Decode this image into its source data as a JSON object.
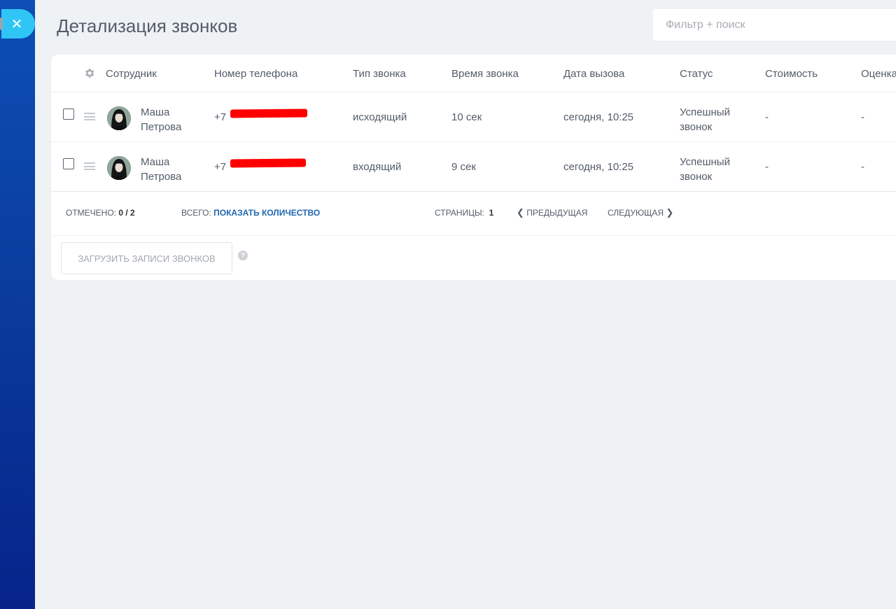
{
  "page": {
    "title": "Детализация звонков",
    "search_placeholder": "Фильтр + поиск",
    "close_icon": "close-icon"
  },
  "table": {
    "columns": [
      "Сотрудник",
      "Номер телефона",
      "Тип звонка",
      "Время звонка",
      "Дата вызова",
      "Статус",
      "Стоимость",
      "Оценка"
    ],
    "rows": [
      {
        "employee_first": "Маша",
        "employee_last": "Петрова",
        "phone_prefix": "+7",
        "phone_redacted": true,
        "type": "исходящий",
        "duration": "10 сек",
        "date": "сегодня, 10:25",
        "status_line1": "Успешный",
        "status_line2": "звонок",
        "cost": "-",
        "rating": "-"
      },
      {
        "employee_first": "Маша",
        "employee_last": "Петрова",
        "phone_prefix": "+7",
        "phone_redacted": true,
        "type": "входящий",
        "duration": "9 сек",
        "date": "сегодня, 10:25",
        "status_line1": "Успешный",
        "status_line2": "звонок",
        "cost": "-",
        "rating": "-"
      }
    ]
  },
  "footer": {
    "selected_label": "Отмечено:",
    "selected_value": "0 / 2",
    "total_label": "Всего:",
    "total_link": "Показать количество",
    "pages_label": "Страницы:",
    "pages_value": "1",
    "prev_label": "Предыдущая",
    "next_label": "Следующая"
  },
  "actions": {
    "load_records_label": "Загрузить записи звонков",
    "help_glyph": "?"
  },
  "colors": {
    "accent": "#2fc6f6",
    "sidebar_top": "#0d4fb6",
    "sidebar_bottom": "#06238a",
    "link": "#2067b0",
    "redaction": "#ff0000"
  }
}
